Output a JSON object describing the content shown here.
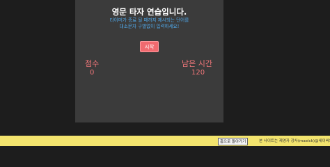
{
  "game": {
    "title": "영문 타자 연습입니다.",
    "instructions": [
      "타이머가 종료 될 때까지 제시되는 단어를",
      "대소문자 구별없이 입력하세요!"
    ],
    "start_label": "시작",
    "score_label": "점수",
    "score_value": "0",
    "time_label": "남은 시간",
    "time_value": "120"
  },
  "footer": {
    "home_label": "홈으로 돌아가기",
    "credit": "본 사이트는 제영자 강사(maeick)@네이버의"
  },
  "colors": {
    "page_background": "#1d1d1d",
    "panel_background": "#3b3b3b",
    "instruction_text": "#4fa7e8",
    "accent_red": "#f06a6f",
    "stat_text": "#f2777a",
    "footer_background": "#f3e46e"
  }
}
